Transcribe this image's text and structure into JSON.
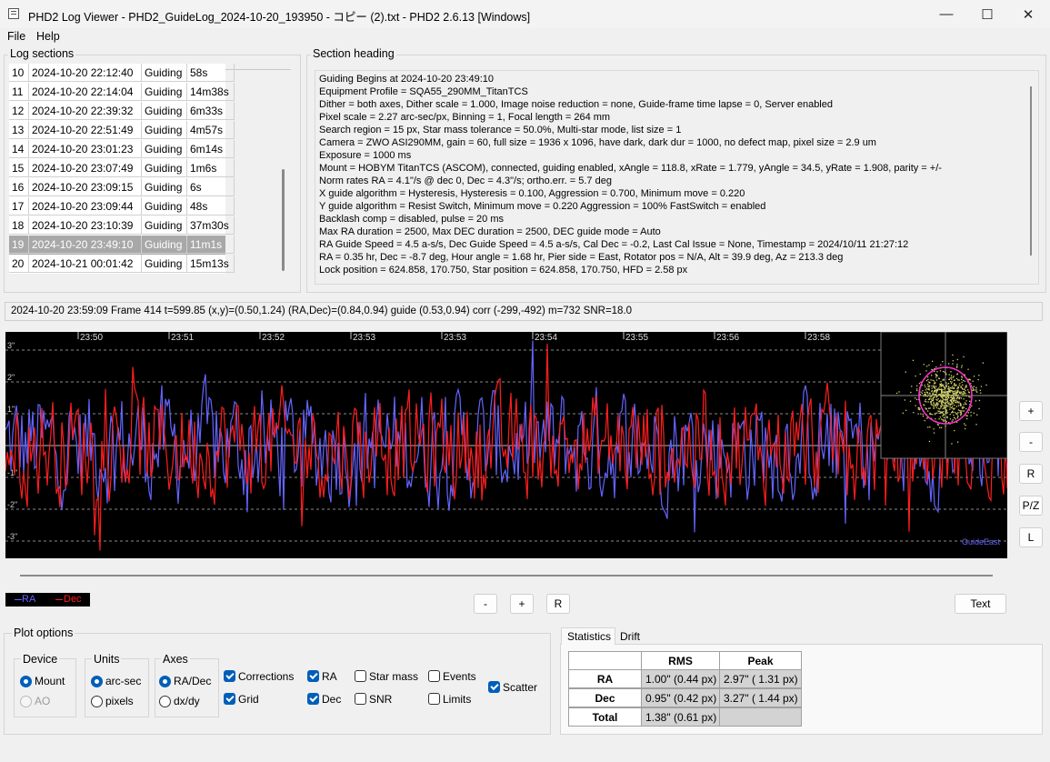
{
  "window": {
    "title": "PHD2 Log Viewer - PHD2_GuideLog_2024-10-20_193950 - コピー (2).txt - PHD2 2.6.13 [Windows]",
    "minimize": "—",
    "maximize": "☐",
    "close": "✕"
  },
  "menu": {
    "file": "File",
    "help": "Help"
  },
  "log_sections": {
    "label": "Log sections",
    "rows": [
      {
        "n": "10",
        "time": "2024-10-20 22:12:40",
        "type": "Guiding",
        "dur": "58s",
        "selected": false
      },
      {
        "n": "11",
        "time": "2024-10-20 22:14:04",
        "type": "Guiding",
        "dur": "14m38s",
        "selected": false
      },
      {
        "n": "12",
        "time": "2024-10-20 22:39:32",
        "type": "Guiding",
        "dur": "6m33s",
        "selected": false
      },
      {
        "n": "13",
        "time": "2024-10-20 22:51:49",
        "type": "Guiding",
        "dur": "4m57s",
        "selected": false
      },
      {
        "n": "14",
        "time": "2024-10-20 23:01:23",
        "type": "Guiding",
        "dur": "6m14s",
        "selected": false
      },
      {
        "n": "15",
        "time": "2024-10-20 23:07:49",
        "type": "Guiding",
        "dur": "1m6s",
        "selected": false
      },
      {
        "n": "16",
        "time": "2024-10-20 23:09:15",
        "type": "Guiding",
        "dur": "6s",
        "selected": false
      },
      {
        "n": "17",
        "time": "2024-10-20 23:09:44",
        "type": "Guiding",
        "dur": "48s",
        "selected": false
      },
      {
        "n": "18",
        "time": "2024-10-20 23:10:39",
        "type": "Guiding",
        "dur": "37m30s",
        "selected": false
      },
      {
        "n": "19",
        "time": "2024-10-20 23:49:10",
        "type": "Guiding",
        "dur": "11m1s",
        "selected": true
      },
      {
        "n": "20",
        "time": "2024-10-21 00:01:42",
        "type": "Guiding",
        "dur": "15m13s",
        "selected": false
      }
    ]
  },
  "section_heading": {
    "label": "Section heading",
    "lines": [
      "Guiding Begins at 2024-10-20 23:49:10",
      "Equipment Profile = SQA55_290MM_TitanTCS",
      "Dither = both axes, Dither scale = 1.000, Image noise reduction = none, Guide-frame time lapse = 0, Server enabled",
      "Pixel scale = 2.27 arc-sec/px, Binning = 1, Focal length = 264 mm",
      "Search region = 15 px, Star mass tolerance = 50.0%, Multi-star mode, list size = 1",
      " Camera = ZWO ASI290MM, gain = 60, full size = 1936 x 1096, have dark, dark dur = 1000, no defect map, pixel size = 2.9 um",
      "Exposure = 1000 ms",
      "Mount = HOBYM TitanTCS (ASCOM), connected, guiding enabled, xAngle = 118.8, xRate = 1.779, yAngle = 34.5, yRate = 1.908, parity = +/-",
      "Norm rates RA = 4.1\"/s @ dec 0, Dec = 4.3\"/s; ortho.err. = 5.7 deg",
      "X guide algorithm = Hysteresis, Hysteresis = 0.100, Aggression = 0.700, Minimum move = 0.220",
      "Y guide algorithm = Resist Switch, Minimum move = 0.220 Aggression = 100% FastSwitch = enabled",
      "Backlash comp = disabled, pulse = 20 ms",
      "Max RA duration = 2500, Max DEC duration = 2500, DEC guide mode = Auto",
      "RA Guide Speed = 4.5 a-s/s, Dec Guide Speed = 4.5 a-s/s, Cal Dec = -0.2, Last Cal Issue = None, Timestamp = 2024/10/11 21:27:12",
      "RA = 0.35 hr, Dec = -8.7 deg, Hour angle = 1.68 hr, Pier side = East, Rotator pos = N/A, Alt = 39.9 deg, Az = 213.3 deg",
      "Lock position = 624.858, 170.750, Star position = 624.858, 170.750, HFD = 2.58 px"
    ]
  },
  "status": "2024-10-20 23:59:09 Frame 414 t=599.85 (x,y)=(0.50,1.24) (RA,Dec)=(0.84,0.94) guide (0.53,0.94) corr (-299,-492) m=732 SNR=18.0",
  "chart_data": {
    "type": "line",
    "x_tick_labels": [
      "23:50",
      "23:51",
      "23:52",
      "23:53",
      "23:53",
      "23:54",
      "23:55",
      "23:56",
      "23:58"
    ],
    "y_tick_labels": [
      "3\"",
      "2\"",
      "1\"",
      "-1\"",
      "-2\"",
      "-3\""
    ],
    "ylim": [
      -3.5,
      3.5
    ],
    "grid": true,
    "series": [
      {
        "name": "RA",
        "color": "#6464ff"
      },
      {
        "name": "Dec",
        "color": "#ff1e1e"
      }
    ],
    "annotation": "GuideEast"
  },
  "plot_side_buttons": {
    "zoom_in": "+",
    "zoom_out": "-",
    "reset": "R",
    "pan_zoom": "P/Z",
    "l": "L"
  },
  "legend": {
    "ra": "RA",
    "dec": "Dec"
  },
  "bottom_buttons": {
    "minus": "-",
    "plus": "+",
    "reset": "R",
    "text": "Text"
  },
  "plot_options": {
    "label": "Plot options",
    "device": {
      "label": "Device",
      "mount": "Mount",
      "ao": "AO"
    },
    "units": {
      "label": "Units",
      "arcsec": "arc-sec",
      "pixels": "pixels"
    },
    "axes": {
      "label": "Axes",
      "radec": "RA/Dec",
      "dxdy": "dx/dy"
    },
    "checks": {
      "corrections": "Corrections",
      "grid": "Grid",
      "ra": "RA",
      "dec": "Dec",
      "starmass": "Star mass",
      "snr": "SNR",
      "events": "Events",
      "limits": "Limits",
      "scatter": "Scatter"
    }
  },
  "stats": {
    "tab_statistics": "Statistics",
    "tab_drift": "Drift",
    "head_rms": "RMS",
    "head_peak": "Peak",
    "rows": [
      {
        "label": "RA",
        "rms": "1.00\" (0.44 px)",
        "peak": "2.97\" ( 1.31 px)"
      },
      {
        "label": "Dec",
        "rms": "0.95\" (0.42 px)",
        "peak": "3.27\" ( 1.44 px)"
      },
      {
        "label": "Total",
        "rms": "1.38\" (0.61 px)",
        "peak": ""
      }
    ]
  },
  "colors": {
    "ra": "#6464ff",
    "dec": "#ff1e1e",
    "accent": "#005fb8",
    "scatter_circle": "#ff33cc",
    "scatter_points": "#d4d46a"
  }
}
